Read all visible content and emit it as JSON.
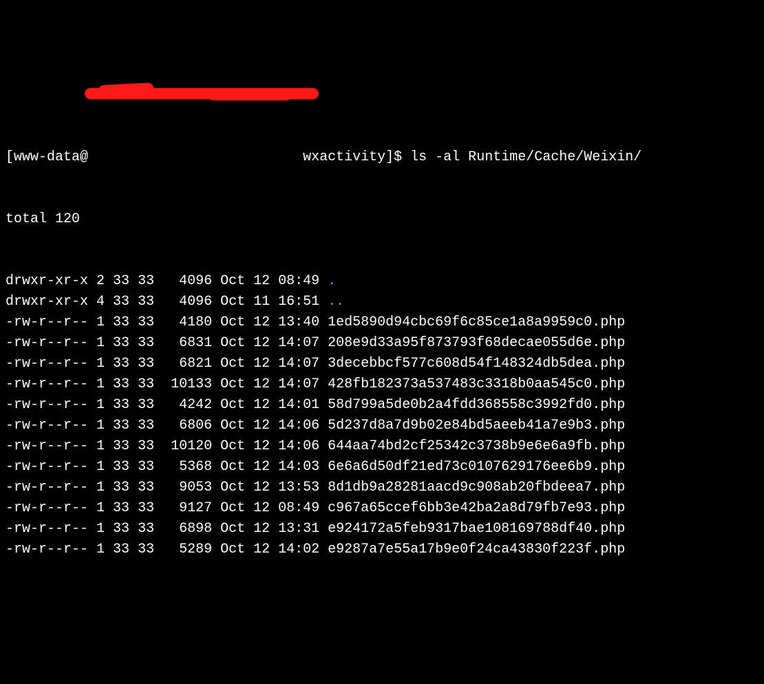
{
  "prompt": {
    "user": "www-data",
    "at": "@",
    "host_obscured": "",
    "host_suffix": "wxactivity",
    "symbol": "]$",
    "command": "ls -al Runtime/Cache/Weixin/"
  },
  "total_label": "total",
  "total_value": "120",
  "entries": [
    {
      "perms": "drwxr-xr-x",
      "links": "2",
      "uid": "33",
      "gid": "33",
      "size": "  4096",
      "date": "Oct 12 08:49",
      "name": ".",
      "is_dir": true
    },
    {
      "perms": "drwxr-xr-x",
      "links": "4",
      "uid": "33",
      "gid": "33",
      "size": "  4096",
      "date": "Oct 11 16:51",
      "name": "..",
      "is_dir": true
    },
    {
      "perms": "-rw-r--r--",
      "links": "1",
      "uid": "33",
      "gid": "33",
      "size": "  4180",
      "date": "Oct 12 13:40",
      "name": "1ed5890d94cbc69f6c85ce1a8a9959c0.php",
      "is_dir": false
    },
    {
      "perms": "-rw-r--r--",
      "links": "1",
      "uid": "33",
      "gid": "33",
      "size": "  6831",
      "date": "Oct 12 14:07",
      "name": "208e9d33a95f873793f68decae055d6e.php",
      "is_dir": false
    },
    {
      "perms": "-rw-r--r--",
      "links": "1",
      "uid": "33",
      "gid": "33",
      "size": "  6821",
      "date": "Oct 12 14:07",
      "name": "3decebbcf577c608d54f148324db5dea.php",
      "is_dir": false
    },
    {
      "perms": "-rw-r--r--",
      "links": "1",
      "uid": "33",
      "gid": "33",
      "size": " 10133",
      "date": "Oct 12 14:07",
      "name": "428fb182373a537483c3318b0aa545c0.php",
      "is_dir": false
    },
    {
      "perms": "-rw-r--r--",
      "links": "1",
      "uid": "33",
      "gid": "33",
      "size": "  4242",
      "date": "Oct 12 14:01",
      "name": "58d799a5de0b2a4fdd368558c3992fd0.php",
      "is_dir": false
    },
    {
      "perms": "-rw-r--r--",
      "links": "1",
      "uid": "33",
      "gid": "33",
      "size": "  6806",
      "date": "Oct 12 14:06",
      "name": "5d237d8a7d9b02e84bd5aeeb41a7e9b3.php",
      "is_dir": false
    },
    {
      "perms": "-rw-r--r--",
      "links": "1",
      "uid": "33",
      "gid": "33",
      "size": " 10120",
      "date": "Oct 12 14:06",
      "name": "644aa74bd2cf25342c3738b9e6e6a9fb.php",
      "is_dir": false
    },
    {
      "perms": "-rw-r--r--",
      "links": "1",
      "uid": "33",
      "gid": "33",
      "size": "  5368",
      "date": "Oct 12 14:03",
      "name": "6e6a6d50df21ed73c0107629176ee6b9.php",
      "is_dir": false
    },
    {
      "perms": "-rw-r--r--",
      "links": "1",
      "uid": "33",
      "gid": "33",
      "size": "  9053",
      "date": "Oct 12 13:53",
      "name": "8d1db9a28281aacd9c908ab20fbdeea7.php",
      "is_dir": false
    },
    {
      "perms": "-rw-r--r--",
      "links": "1",
      "uid": "33",
      "gid": "33",
      "size": "  9127",
      "date": "Oct 12 08:49",
      "name": "c967a65ccef6bb3e42ba2a8d79fb7e93.php",
      "is_dir": false
    },
    {
      "perms": "-rw-r--r--",
      "links": "1",
      "uid": "33",
      "gid": "33",
      "size": "  6898",
      "date": "Oct 12 13:31",
      "name": "e924172a5feb9317bae108169788df40.php",
      "is_dir": false
    },
    {
      "perms": "-rw-r--r--",
      "links": "1",
      "uid": "33",
      "gid": "33",
      "size": "  5289",
      "date": "Oct 12 14:02",
      "name": "e9287a7e55a17b9e0f24ca43830f223f.php",
      "is_dir": false
    }
  ]
}
